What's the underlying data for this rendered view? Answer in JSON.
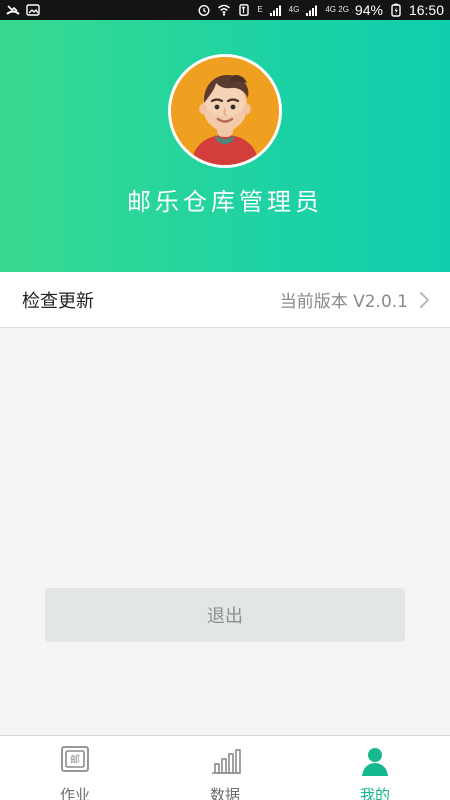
{
  "status_bar": {
    "network_small": "E",
    "network_4g": "4G",
    "network_4g2g": "4G 2G",
    "battery_percent": "94%",
    "time": "16:50"
  },
  "profile": {
    "username": "邮乐仓库管理员"
  },
  "settings": {
    "check_update_label": "检查更新",
    "current_version": "当前版本 V2.0.1"
  },
  "actions": {
    "logout_label": "退出"
  },
  "bottom_nav": {
    "items": [
      {
        "label": "作业",
        "icon_text": "邮"
      },
      {
        "label": "数据"
      },
      {
        "label": "我的"
      }
    ]
  },
  "colors": {
    "accent": "#16b98f",
    "header_start": "#39d98f",
    "header_end": "#10cfae"
  }
}
